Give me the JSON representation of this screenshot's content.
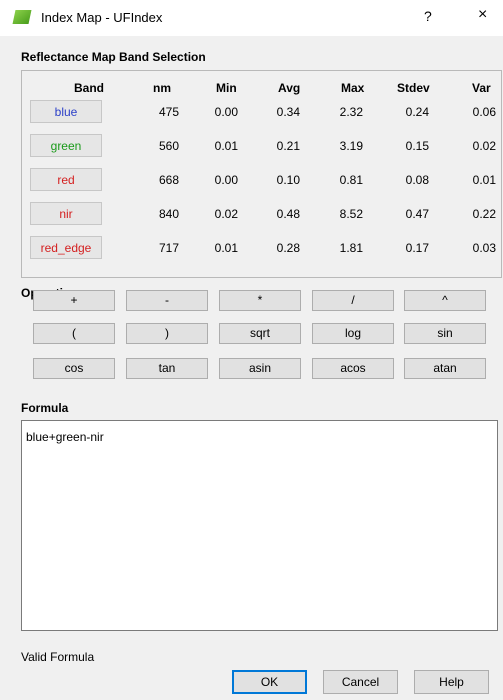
{
  "window": {
    "title": "Index Map - UFIndex",
    "help": "?",
    "close": "×"
  },
  "bands_section": {
    "title": "Reflectance Map Band Selection"
  },
  "table": {
    "headers": [
      "Band",
      "nm",
      "Min",
      "Avg",
      "Max",
      "Stdev",
      "Var"
    ],
    "rows": [
      {
        "band": "blue",
        "color": "#2b3fc8",
        "nm": "475",
        "min": "0.00",
        "avg": "0.34",
        "max": "2.32",
        "stdev": "0.24",
        "var": "0.06"
      },
      {
        "band": "green",
        "color": "#1a9a1a",
        "nm": "560",
        "min": "0.01",
        "avg": "0.21",
        "max": "3.19",
        "stdev": "0.15",
        "var": "0.02"
      },
      {
        "band": "red",
        "color": "#d42020",
        "nm": "668",
        "min": "0.00",
        "avg": "0.10",
        "max": "0.81",
        "stdev": "0.08",
        "var": "0.01"
      },
      {
        "band": "nir",
        "color": "#d42020",
        "nm": "840",
        "min": "0.02",
        "avg": "0.48",
        "max": "8.52",
        "stdev": "0.47",
        "var": "0.22"
      },
      {
        "band": "red_edge",
        "color": "#d42020",
        "nm": "717",
        "min": "0.01",
        "avg": "0.28",
        "max": "1.81",
        "stdev": "0.17",
        "var": "0.03"
      }
    ]
  },
  "operations": {
    "title": "Operations",
    "buttons": [
      "+",
      "-",
      "*",
      "/",
      "^",
      "(",
      ")",
      "sqrt",
      "log",
      "sin",
      "cos",
      "tan",
      "asin",
      "acos",
      "atan"
    ]
  },
  "formula": {
    "title": "Formula",
    "value": "blue+green-nir"
  },
  "status": "Valid Formula",
  "footer": {
    "ok": "OK",
    "cancel": "Cancel",
    "help": "Help"
  }
}
